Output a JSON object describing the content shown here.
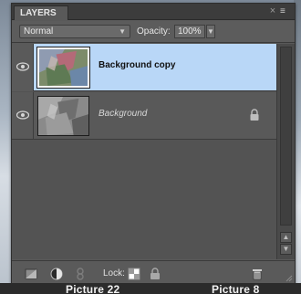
{
  "panel": {
    "tab_label": "LAYERS",
    "close_glyph": "×",
    "menu_glyph": "≡"
  },
  "options": {
    "blend_mode": "Normal",
    "opacity_label": "Opacity:",
    "opacity_value": "100%"
  },
  "layers": [
    {
      "name": "Background copy",
      "selected": true,
      "visible": true,
      "locked": false,
      "icon": "eye-icon"
    },
    {
      "name": "Background",
      "selected": false,
      "visible": true,
      "locked": true,
      "icon": "eye-icon"
    }
  ],
  "footer": {
    "lock_label": "Lock:",
    "icons": [
      "link-layers-icon",
      "adjustment-layer-icon",
      "chain-icon",
      "lock-transparent-pixels-icon",
      "lock-all-icon",
      "trash-icon"
    ]
  },
  "captions": {
    "left": "Picture 22",
    "right": "Picture 8"
  },
  "colors": {
    "selected_row": "#b9d7f7",
    "panel_bg": "#595959"
  }
}
